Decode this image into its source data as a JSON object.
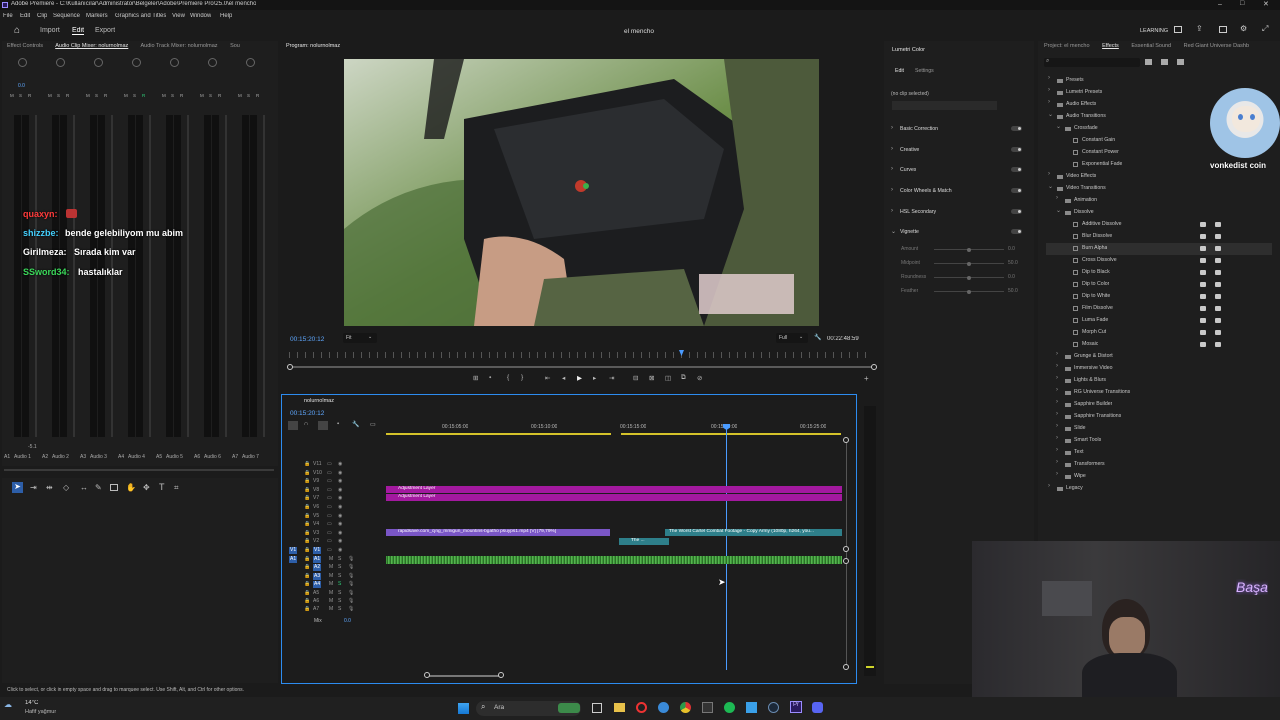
{
  "window": {
    "title": "Adobe Premiere - C:\\Kullanıcılar\\Administrator\\Belgeler\\Adobe\\Premiere Pro\\25.0\\el mencho",
    "project_name": "el mencho"
  },
  "menu": [
    "File",
    "Edit",
    "Clip",
    "Sequence",
    "Markers",
    "Graphics and Titles",
    "View",
    "Window",
    "Help"
  ],
  "workspace": {
    "tabs": [
      "Import",
      "Edit",
      "Export"
    ],
    "active": "Edit",
    "learning": "LEARNING"
  },
  "left_panel": {
    "tabs": [
      "Effect Controls",
      "Audio Clip Mixer: nolurnolmaz",
      "Audio Track Mixer: nolurnolmaz",
      "Sou"
    ],
    "channels": [
      "Audio 1",
      "Audio 2",
      "Audio 3",
      "Audio 4",
      "Audio 5",
      "Audio 6",
      "Audio 7"
    ],
    "channel_codes": [
      "A1",
      "A2",
      "A3",
      "A4",
      "A5",
      "A6",
      "A7"
    ],
    "master_values": [
      "0.0",
      "-5.1"
    ]
  },
  "chat": [
    {
      "user": "quaxyn:",
      "msg": "",
      "color": "#ff3b3b"
    },
    {
      "user": "shizzbe:",
      "msg": "bende gelebiliyom mu abim",
      "color": "#45d1ff"
    },
    {
      "user": "Girilmeza:",
      "msg": "Sırada kim var",
      "color": "#ffffff"
    },
    {
      "user": "SSword34:",
      "msg": "hastalıklar",
      "color": "#3bd95a"
    }
  ],
  "program": {
    "tab": "Program: nolurnolmaz",
    "timecode": "00:15:20:12",
    "fit": "Fit",
    "quality": "Full",
    "duration": "00:22:48:59"
  },
  "sequence": {
    "tab": "nolurnolmaz",
    "timecode": "00:15:20:12",
    "ruler": [
      "00:15:05:00",
      "00:15:10:00",
      "00:15:15:00",
      "00:15:20:00",
      "00:15:25:00"
    ],
    "video_tracks": [
      "V11",
      "V10",
      "V9",
      "V8",
      "V7",
      "V6",
      "V5",
      "V4",
      "V3",
      "V2",
      "V1"
    ],
    "audio_tracks": [
      "A1",
      "A2",
      "A3",
      "A4",
      "A5",
      "A6",
      "A7"
    ],
    "mix": "Mix",
    "mix_value": "0.0",
    "clips": {
      "adjustment1": "Adjustment Layer",
      "adjustment2": "Adjustment Layer",
      "video1": "rapidsave.com_cjng_mmigun_mountins-bgatho psuyps1.mp4 [V] [79,79%]",
      "video2": "The ...",
      "video3": "The Worst Cartel Combat Footage - Copy Army (1080p, h264, you..."
    }
  },
  "lumetri": {
    "tab": "Lumetri Color",
    "sub_tabs": [
      "Edit",
      "Settings"
    ],
    "no_clip": "(no clip selected)",
    "sections": [
      "Basic Correction",
      "Creative",
      "Curves",
      "Color Wheels & Match",
      "HSL Secondary",
      "Vignette"
    ],
    "vignette_params": [
      {
        "name": "Amount",
        "value": "0.0"
      },
      {
        "name": "Midpoint",
        "value": "50.0"
      },
      {
        "name": "Roundness",
        "value": "0.0"
      },
      {
        "name": "Feather",
        "value": "50.0"
      }
    ]
  },
  "effects": {
    "tabs": [
      "Project: el mencho",
      "Effects",
      "Essential Sound",
      "Red Giant Universe Dashb"
    ],
    "active_tab": "Effects",
    "tree": [
      {
        "label": "Presets",
        "level": 0,
        "type": "folder",
        "open": false
      },
      {
        "label": "Lumetri Presets",
        "level": 0,
        "type": "folder",
        "open": false
      },
      {
        "label": "Audio Effects",
        "level": 0,
        "type": "folder",
        "open": false
      },
      {
        "label": "Audio Transitions",
        "level": 0,
        "type": "folder",
        "open": true
      },
      {
        "label": "Crossfade",
        "level": 1,
        "type": "folder",
        "open": true
      },
      {
        "label": "Constant Gain",
        "level": 2,
        "type": "fx"
      },
      {
        "label": "Constant Power",
        "level": 2,
        "type": "fx"
      },
      {
        "label": "Exponential Fade",
        "level": 2,
        "type": "fx"
      },
      {
        "label": "Video Effects",
        "level": 0,
        "type": "folder",
        "open": false
      },
      {
        "label": "Video Transitions",
        "level": 0,
        "type": "folder",
        "open": true
      },
      {
        "label": "Animation",
        "level": 1,
        "type": "folder",
        "open": false
      },
      {
        "label": "Dissolve",
        "level": 1,
        "type": "folder",
        "open": true
      },
      {
        "label": "Additive Dissolve",
        "level": 2,
        "type": "fx",
        "badges": true
      },
      {
        "label": "Blur Dissolve",
        "level": 2,
        "type": "fx",
        "badges": true
      },
      {
        "label": "Burn Alpha",
        "level": 2,
        "type": "fx",
        "badges": true,
        "selected": true
      },
      {
        "label": "Cross Dissolve",
        "level": 2,
        "type": "fx",
        "badges": true
      },
      {
        "label": "Dip to Black",
        "level": 2,
        "type": "fx",
        "badges": true
      },
      {
        "label": "Dip to Color",
        "level": 2,
        "type": "fx",
        "badges": true
      },
      {
        "label": "Dip to White",
        "level": 2,
        "type": "fx",
        "badges": true
      },
      {
        "label": "Film Dissolve",
        "level": 2,
        "type": "fx",
        "badges": true
      },
      {
        "label": "Luma Fade",
        "level": 2,
        "type": "fx",
        "badges": true
      },
      {
        "label": "Morph Cut",
        "level": 2,
        "type": "fx",
        "badges": true
      },
      {
        "label": "Mosaic",
        "level": 2,
        "type": "fx",
        "badges": true
      },
      {
        "label": "Grunge & Distort",
        "level": 1,
        "type": "folder",
        "open": false
      },
      {
        "label": "Immersive Video",
        "level": 1,
        "type": "folder",
        "open": false
      },
      {
        "label": "Lights & Blurs",
        "level": 1,
        "type": "folder",
        "open": false
      },
      {
        "label": "RG Universe Transitions",
        "level": 1,
        "type": "folder",
        "open": false
      },
      {
        "label": "Sapphire Builder",
        "level": 1,
        "type": "folder",
        "open": false
      },
      {
        "label": "Sapphire Transitions",
        "level": 1,
        "type": "folder",
        "open": false
      },
      {
        "label": "Slide",
        "level": 1,
        "type": "folder",
        "open": false
      },
      {
        "label": "Smart Tools",
        "level": 1,
        "type": "folder",
        "open": false
      },
      {
        "label": "Text",
        "level": 1,
        "type": "folder",
        "open": false
      },
      {
        "label": "Transformers",
        "level": 1,
        "type": "folder",
        "open": false
      },
      {
        "label": "Wipe",
        "level": 1,
        "type": "folder",
        "open": false
      },
      {
        "label": "Legacy",
        "level": 0,
        "type": "folder",
        "open": false
      }
    ]
  },
  "overlay": {
    "brand": "vonkedist coin",
    "neon": "Başa"
  },
  "status_bar": "Click to select, or click in empty space and drag to marquee select. Use Shift, Alt, and Ctrl for other options.",
  "taskbar": {
    "weather_temp": "14°C",
    "weather_desc": "Hafif yağmur",
    "search": "Ara"
  },
  "colors": {
    "accent": "#2d8cf0",
    "adjustment": "#a3199f",
    "clip_video": "#7a56c6",
    "clip_teal": "#2e7f8a",
    "waveform": "#3e9a3a",
    "playhead": "#4a9bff"
  }
}
